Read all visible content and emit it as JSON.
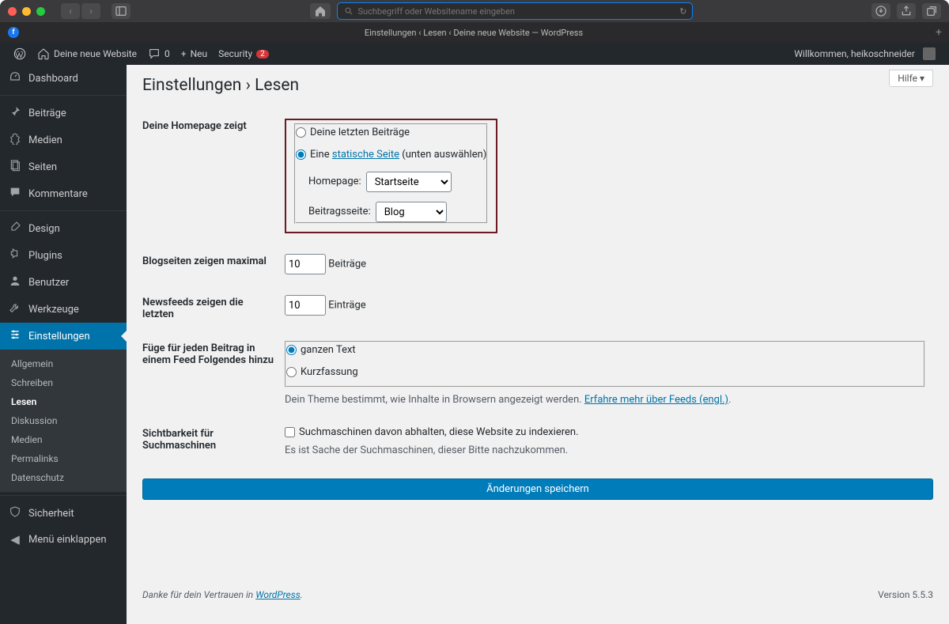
{
  "browser": {
    "url_placeholder": "Suchbegriff oder Websitename eingeben",
    "tab_title": "Einstellungen ‹ Lesen ‹ Deine neue Website — WordPress"
  },
  "adminbar": {
    "site_name": "Deine neue Website",
    "comments_count": "0",
    "new_label": "Neu",
    "security_label": "Security",
    "security_count": "2",
    "welcome": "Willkommen, heikoschneider"
  },
  "menu": {
    "dashboard": "Dashboard",
    "posts": "Beiträge",
    "media": "Medien",
    "pages": "Seiten",
    "comments": "Kommentare",
    "appearance": "Design",
    "plugins": "Plugins",
    "users": "Benutzer",
    "tools": "Werkzeuge",
    "settings": "Einstellungen",
    "security": "Sicherheit",
    "collapse": "Menü einklappen",
    "sub": {
      "general": "Allgemein",
      "writing": "Schreiben",
      "reading": "Lesen",
      "discussion": "Diskussion",
      "media": "Medien",
      "permalinks": "Permalinks",
      "privacy": "Datenschutz"
    }
  },
  "page": {
    "help": "Hilfe ▾",
    "title": "Einstellungen › Lesen",
    "row_homepage": "Deine Homepage zeigt",
    "opt_latest": "Deine letzten Beiträge",
    "opt_static_pre": "Eine ",
    "opt_static_link": "statische Seite",
    "opt_static_post": " (unten auswählen)",
    "homepage_label": "Homepage:",
    "homepage_value": "Startseite",
    "posts_page_label": "Beitragsseite:",
    "posts_page_value": "Blog",
    "row_posts_max": "Blogseiten zeigen maximal",
    "posts_max_value": "10",
    "posts_max_unit": "Beiträge",
    "row_feed_max": "Newsfeeds zeigen die letzten",
    "feed_max_value": "10",
    "feed_max_unit": "Einträge",
    "row_feed_content": "Füge für jeden Beitrag in einem Feed Folgendes hinzu",
    "feed_full": "ganzen Text",
    "feed_summary": "Kurzfassung",
    "feed_desc_pre": "Dein Theme bestimmt, wie Inhalte in Browsern angezeigt werden. ",
    "feed_desc_link": "Erfahre mehr über Feeds (engl.)",
    "row_seo": "Sichtbarkeit für Suchmaschinen",
    "seo_label": "Suchmaschinen davon abhalten, diese Website zu indexieren.",
    "seo_desc": "Es ist Sache der Suchmaschinen, dieser Bitte nachzukommen.",
    "save": "Änderungen speichern",
    "footer_pre": "Danke für dein Vertrauen in ",
    "footer_link": "WordPress",
    "version": "Version 5.5.3"
  }
}
